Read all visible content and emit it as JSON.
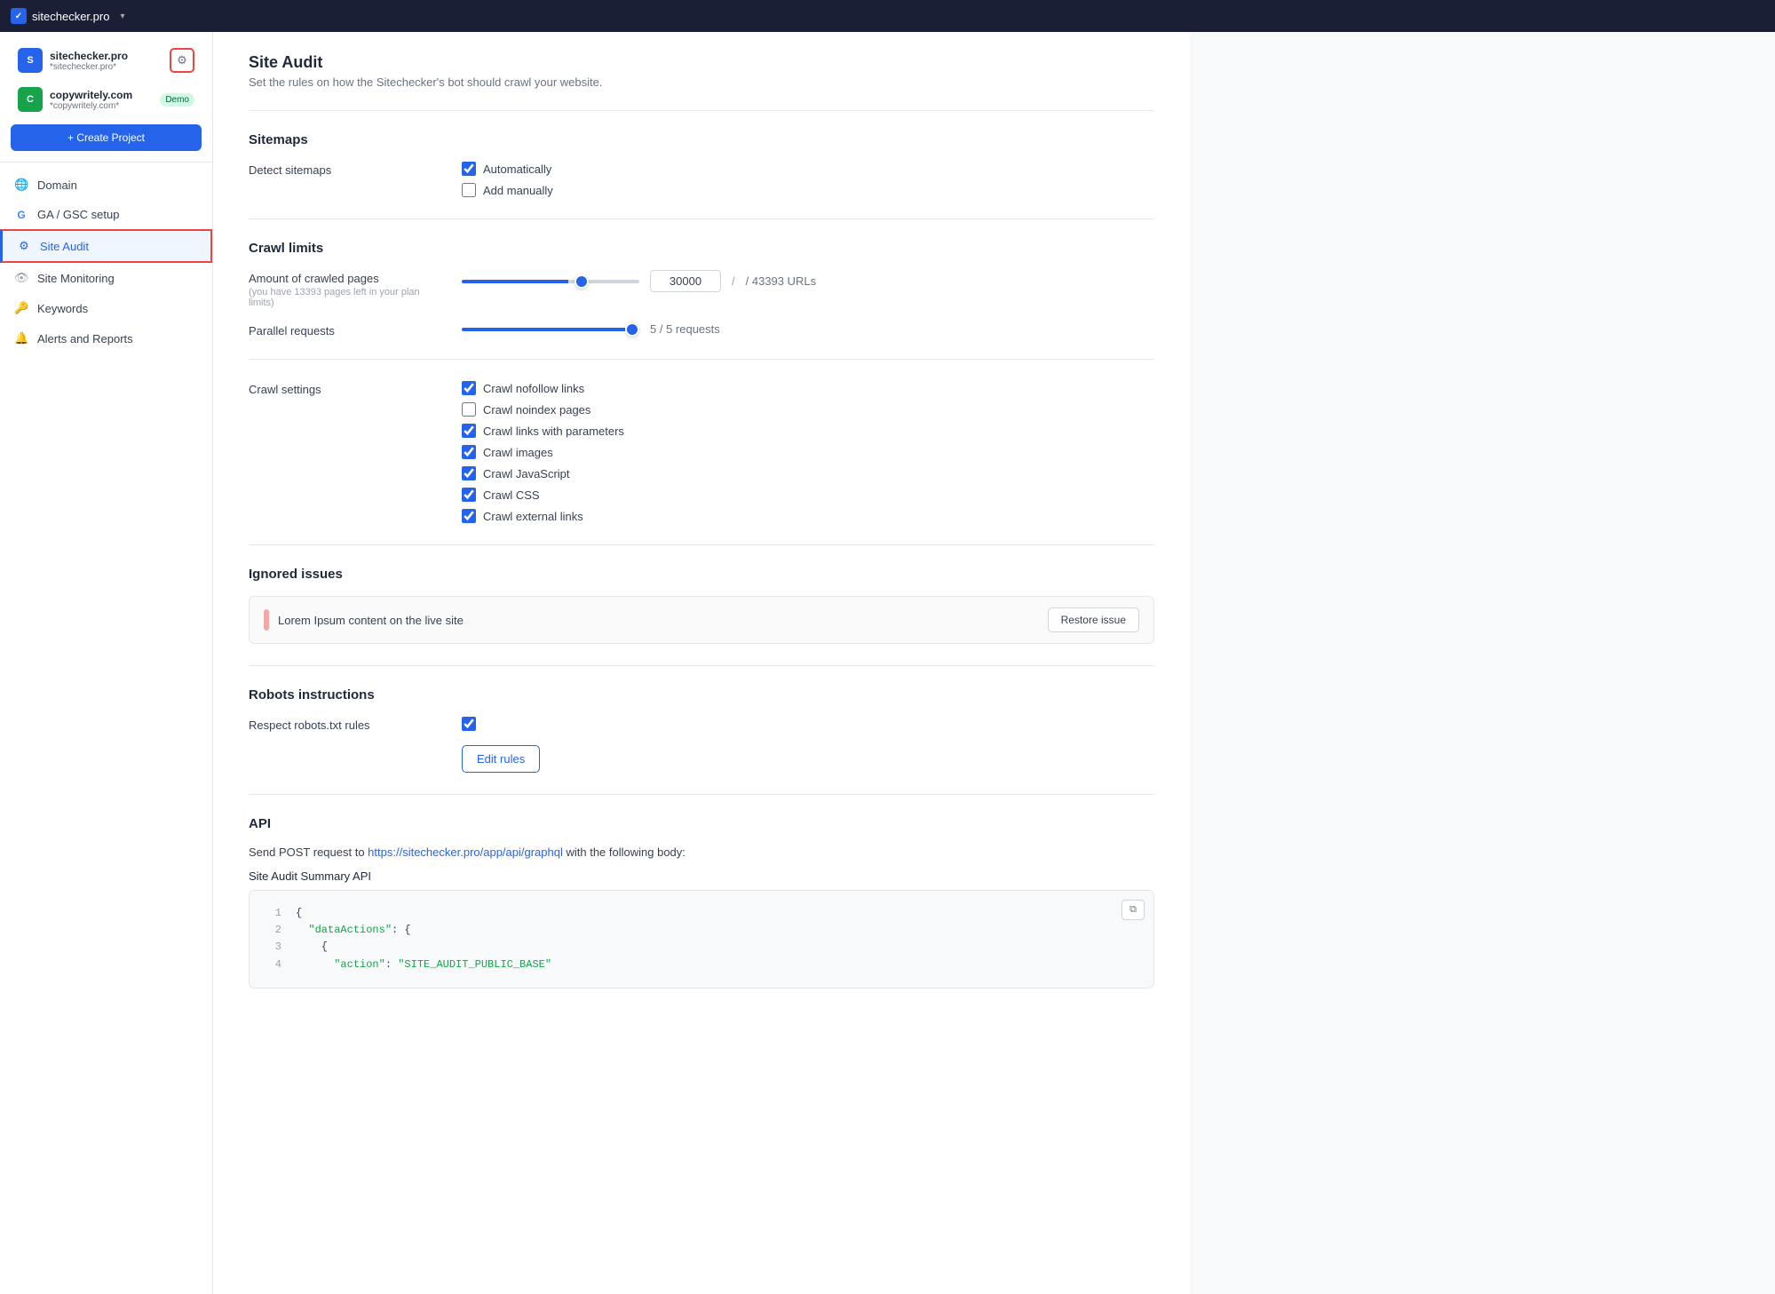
{
  "topbar": {
    "site_name": "sitechecker.pro",
    "chevron": "▾"
  },
  "sidebar": {
    "projects": [
      {
        "name": "sitechecker.pro",
        "url": "*sitechecker.pro*",
        "icon_text": "S",
        "icon_color": "#2563eb",
        "badge": null
      },
      {
        "name": "copywritely.com",
        "url": "*copywritely.com*",
        "icon_text": "C",
        "icon_color": "#16a34a",
        "badge": "Demo"
      }
    ],
    "create_project_label": "+ Create Project",
    "nav_items": [
      {
        "id": "domain",
        "label": "Domain",
        "icon": "🌐"
      },
      {
        "id": "ga-gsc",
        "label": "GA / GSC setup",
        "icon": "G"
      },
      {
        "id": "site-audit",
        "label": "Site Audit",
        "icon": "⚙",
        "active": true
      },
      {
        "id": "site-monitoring",
        "label": "Site Monitoring",
        "icon": "👁"
      },
      {
        "id": "keywords",
        "label": "Keywords",
        "icon": "🔑"
      },
      {
        "id": "alerts-reports",
        "label": "Alerts and Reports",
        "icon": "🔔"
      }
    ]
  },
  "main": {
    "page_title": "Site Audit",
    "page_subtitle": "Set the rules on how the Sitechecker's bot should crawl your website.",
    "sections": {
      "sitemaps": {
        "title": "Sitemaps",
        "detect_sitemaps_label": "Detect sitemaps",
        "options": [
          {
            "label": "Automatically",
            "checked": true
          },
          {
            "label": "Add manually",
            "checked": false
          }
        ]
      },
      "crawl_limits": {
        "title": "Crawl limits",
        "crawled_pages_label": "Amount of crawled pages",
        "crawled_pages_sub": "(you have 13393 pages left in your plan limits)",
        "crawled_pages_value": "30000",
        "crawled_pages_total": "/ 43393 URLs",
        "slider_crawl_percent": 60,
        "parallel_requests_label": "Parallel requests",
        "parallel_requests_value": "5 / 5 requests",
        "slider_parallel_percent": 100
      },
      "crawl_settings": {
        "title": "Crawl settings",
        "label": "Crawl settings",
        "options": [
          {
            "label": "Crawl nofollow links",
            "checked": true
          },
          {
            "label": "Crawl noindex pages",
            "checked": false
          },
          {
            "label": "Crawl links with parameters",
            "checked": true
          },
          {
            "label": "Crawl images",
            "checked": true
          },
          {
            "label": "Crawl JavaScript",
            "checked": true
          },
          {
            "label": "Crawl CSS",
            "checked": true
          },
          {
            "label": "Crawl external links",
            "checked": true
          }
        ]
      },
      "ignored_issues": {
        "title": "Ignored issues",
        "issues": [
          {
            "text": "Lorem Ipsum content on the live site",
            "color": "#fca5a5"
          }
        ],
        "restore_label": "Restore issue"
      },
      "robots": {
        "title": "Robots instructions",
        "respect_label": "Respect robots.txt rules",
        "checked": true,
        "edit_rules_label": "Edit rules"
      },
      "api": {
        "title": "API",
        "description_prefix": "Send POST request to ",
        "api_url": "https://sitechecker.pro/app/api/graphql",
        "description_suffix": " with the following body:",
        "summary_label": "Site Audit Summary API",
        "code_lines": [
          {
            "num": 1,
            "content": "{"
          },
          {
            "num": 2,
            "content": "  \"dataActions\": {"
          },
          {
            "num": 3,
            "content": "    {"
          },
          {
            "num": 4,
            "content": "      \"action\": \"SITE_AUDIT_PUBLIC_BASE\""
          }
        ]
      }
    }
  }
}
